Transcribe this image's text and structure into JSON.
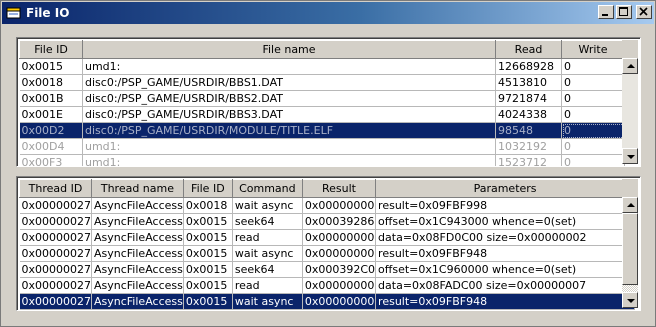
{
  "window": {
    "title": "File IO"
  },
  "files_table": {
    "columns": [
      "File ID",
      "File name",
      "Read",
      "Write"
    ],
    "rows": [
      {
        "id": "0x0015",
        "name": "umd1:",
        "read": "12668928",
        "write": "0"
      },
      {
        "id": "0x0018",
        "name": "disc0:/PSP_GAME/USRDIR/BBS1.DAT",
        "read": "4513810",
        "write": "0"
      },
      {
        "id": "0x001B",
        "name": "disc0:/PSP_GAME/USRDIR/BBS2.DAT",
        "read": "9721874",
        "write": "0"
      },
      {
        "id": "0x001E",
        "name": "disc0:/PSP_GAME/USRDIR/BBS3.DAT",
        "read": "4024338",
        "write": "0"
      },
      {
        "id": "0x00D2",
        "name": "disc0:/PSP_GAME/USRDIR/MODULE/TITLE.ELF",
        "read": "98548",
        "write": "0"
      },
      {
        "id": "0x00D4",
        "name": "umd1:",
        "read": "1032192",
        "write": "0"
      },
      {
        "id": "0x00F3",
        "name": "umd1:",
        "read": "1523712",
        "write": "0"
      }
    ]
  },
  "commands_table": {
    "columns": [
      "Thread ID",
      "Thread name",
      "File ID",
      "Command",
      "Result",
      "Parameters"
    ],
    "rows": [
      {
        "tid": "0x00000027",
        "tname": "AsyncFileAccess",
        "fid": "0x0018",
        "cmd": "wait async",
        "result": "0x00000000",
        "params": "result=0x09FBF998"
      },
      {
        "tid": "0x00000027",
        "tname": "AsyncFileAccess",
        "fid": "0x0015",
        "cmd": "seek64",
        "result": "0x00039286",
        "params": "offset=0x1C943000 whence=0(set)"
      },
      {
        "tid": "0x00000027",
        "tname": "AsyncFileAccess",
        "fid": "0x0015",
        "cmd": "read",
        "result": "0x00000000",
        "params": "data=0x08FD0C00 size=0x00000002"
      },
      {
        "tid": "0x00000027",
        "tname": "AsyncFileAccess",
        "fid": "0x0015",
        "cmd": "wait async",
        "result": "0x00000000",
        "params": "result=0x09FBF948"
      },
      {
        "tid": "0x00000027",
        "tname": "AsyncFileAccess",
        "fid": "0x0015",
        "cmd": "seek64",
        "result": "0x000392C0",
        "params": "offset=0x1C960000 whence=0(set)"
      },
      {
        "tid": "0x00000027",
        "tname": "AsyncFileAccess",
        "fid": "0x0015",
        "cmd": "read",
        "result": "0x00000000",
        "params": "data=0x08FADC00 size=0x00000007"
      },
      {
        "tid": "0x00000027",
        "tname": "AsyncFileAccess",
        "fid": "0x0015",
        "cmd": "wait async",
        "result": "0x00000000",
        "params": "result=0x09FBF948"
      }
    ]
  },
  "colors": {
    "selection": "#0a246a",
    "title_start": "#0a246a",
    "title_end": "#a6caf0"
  },
  "icons": [
    "window-app-icon",
    "minimize-icon",
    "maximize-icon",
    "close-icon",
    "scroll-up-icon",
    "scroll-down-icon"
  ]
}
